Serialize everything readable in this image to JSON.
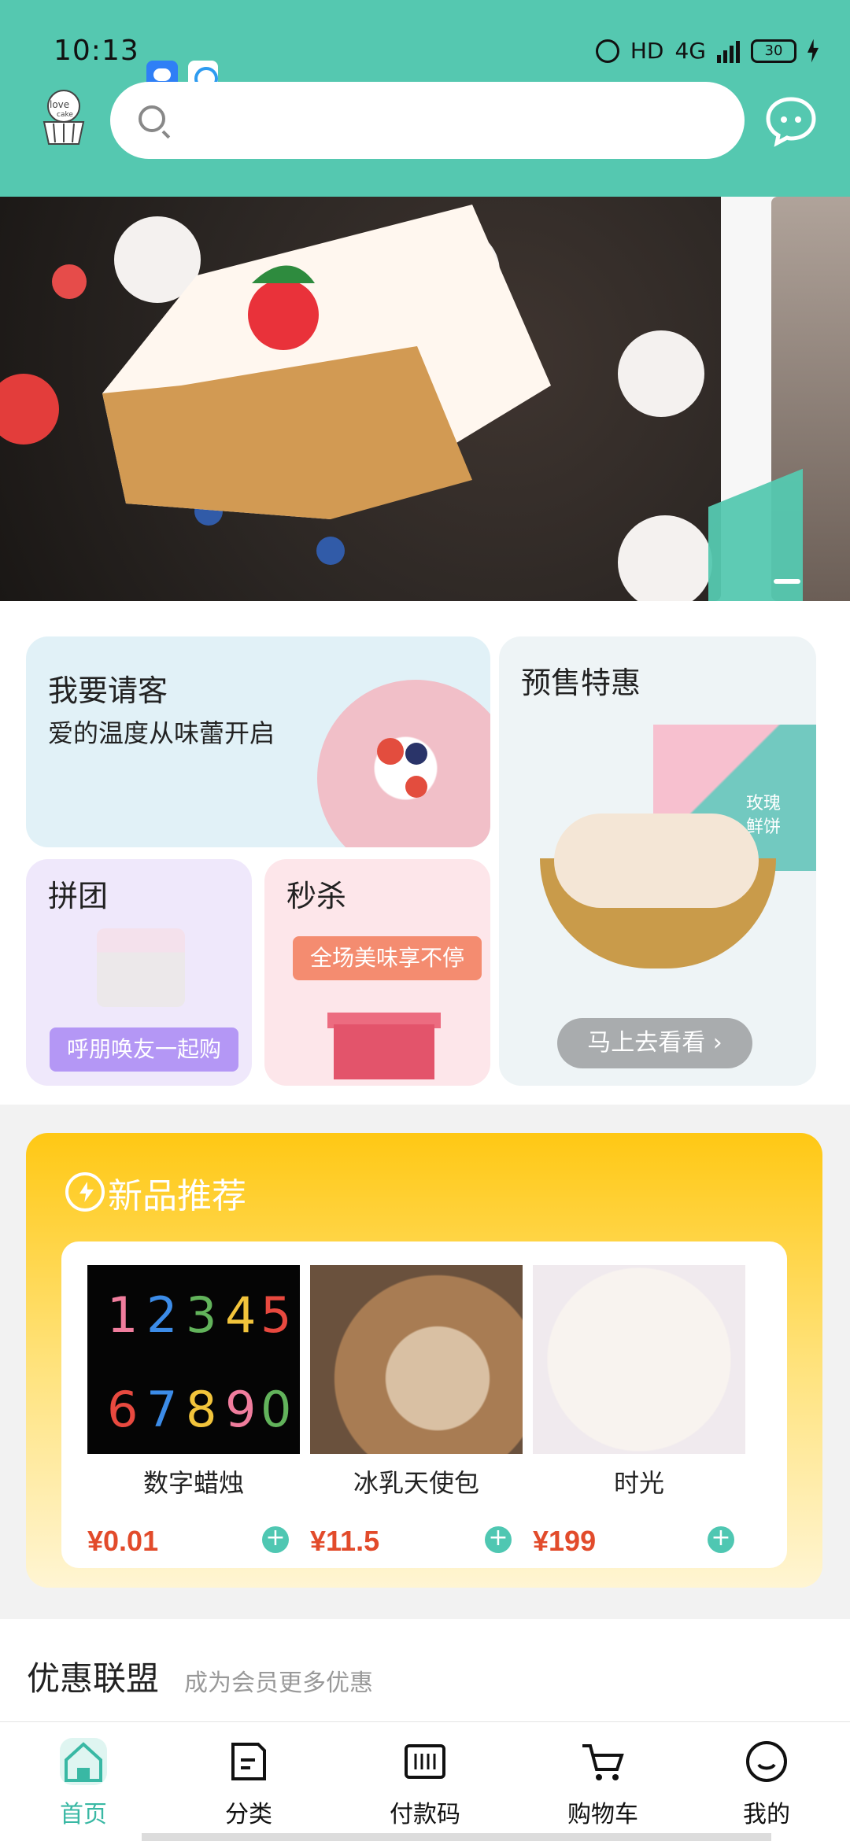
{
  "status_bar": {
    "time": "10:13",
    "hd": "HD",
    "network": "4G",
    "battery": "30"
  },
  "header": {
    "logo_text": "love cake",
    "search_placeholder": ""
  },
  "promo": {
    "treat": {
      "title": "我要请客",
      "subtitle": "爱的温度从味蕾开启"
    },
    "group_buy": {
      "title": "拼团",
      "button": "呼朋唤友一起购"
    },
    "flash_sale": {
      "title": "秒杀",
      "tag": "全场美味享不停"
    },
    "presale": {
      "title": "预售特惠",
      "button": "马上去看看 ›",
      "box_text": "玫瑰鲜饼"
    }
  },
  "new_products": {
    "title": "新品推荐",
    "items": [
      {
        "name": "数字蜡烛",
        "price": "¥0.01",
        "add": "+"
      },
      {
        "name": "冰乳天使包",
        "price": "¥11.5",
        "add": "+"
      },
      {
        "name": "时光",
        "price": "¥199",
        "add": "+"
      }
    ]
  },
  "discount_union": {
    "title": "优惠联盟",
    "subtitle": "成为会员更多优惠"
  },
  "bottom_nav": {
    "tabs": [
      {
        "label": "首页",
        "icon": "home-icon",
        "active": true
      },
      {
        "label": "分类",
        "icon": "category-icon",
        "active": false
      },
      {
        "label": "付款码",
        "icon": "barcode-icon",
        "active": false
      },
      {
        "label": "购物车",
        "icon": "cart-icon",
        "active": false
      },
      {
        "label": "我的",
        "icon": "profile-icon",
        "active": false
      }
    ]
  },
  "colors": {
    "primary": "#55c8b0",
    "accent": "#39b8a4",
    "price": "#e24b2b",
    "new_section": "#ffc814"
  }
}
